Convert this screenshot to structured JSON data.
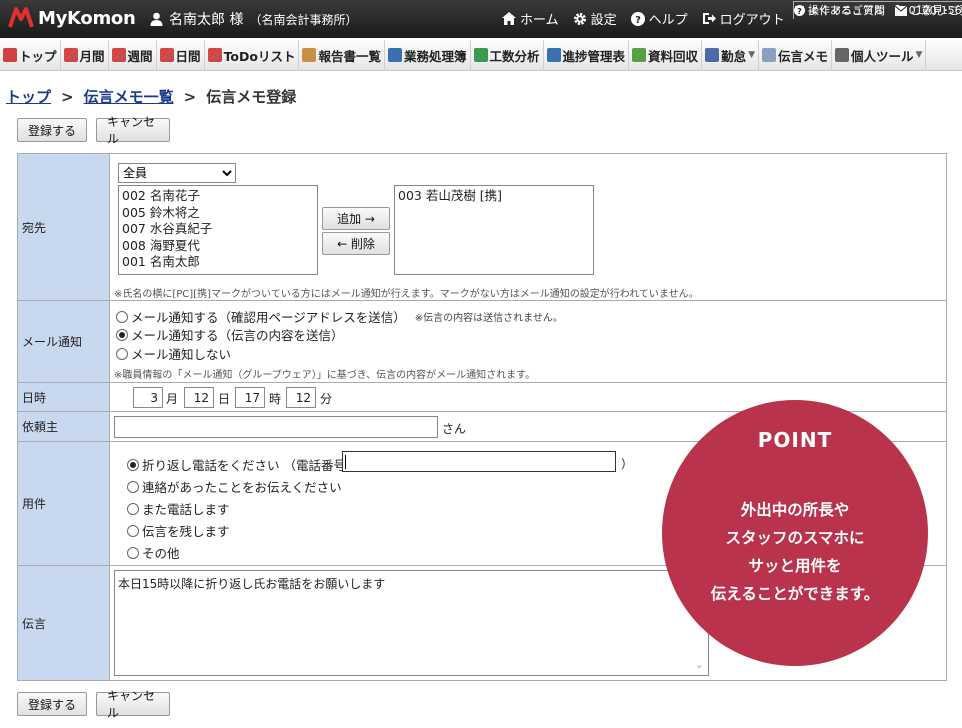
{
  "header": {
    "logo": "MyKomon",
    "user_name": "名南太郎 様",
    "user_org": "（名南会計事務所）",
    "nav": [
      {
        "label": "ホーム",
        "icon": "home-icon"
      },
      {
        "label": "設定",
        "icon": "gear-icon"
      },
      {
        "label": "ヘルプ",
        "icon": "help-icon"
      },
      {
        "label": "ログアウト",
        "icon": "logout-icon"
      }
    ],
    "manual": "操作マニュアル",
    "phone": "0120-156027",
    "faq": "よくあるご質問",
    "feedback": "ご意見･ご要望"
  },
  "menu": [
    {
      "label": "トップ",
      "color": "#d04040"
    },
    {
      "label": "月間",
      "color": "#d04848"
    },
    {
      "label": "週間",
      "color": "#d04848"
    },
    {
      "label": "日間",
      "color": "#d04848"
    },
    {
      "label": "ToDoリスト",
      "color": "#d04848"
    },
    {
      "label": "報告書一覧",
      "color": "#c89040"
    },
    {
      "label": "業務処理簿",
      "color": "#3a70b0"
    },
    {
      "label": "工数分析",
      "color": "#3a9a50"
    },
    {
      "label": "進捗管理表",
      "color": "#3a70b0"
    },
    {
      "label": "資料回収",
      "color": "#58a048"
    },
    {
      "label": "勤怠",
      "color": "#4a6aa8",
      "dropdown": true
    },
    {
      "label": "伝言メモ",
      "color": "#8aa0c0"
    },
    {
      "label": "個人ツール",
      "color": "#666666",
      "dropdown": true
    }
  ],
  "breadcrumb": {
    "top": "トップ",
    "list": "伝言メモ一覧",
    "current": "伝言メモ登録",
    "sep": ">"
  },
  "buttons": {
    "register": "登録する",
    "cancel": "キャンセル"
  },
  "form": {
    "to": {
      "label": "宛先",
      "group_selected": "全員",
      "candidates": [
        "002 名南花子",
        "005 鈴木将之",
        "007 水谷真紀子",
        "008 海野夏代",
        "001 名南太郎"
      ],
      "add_button": "追加 →",
      "remove_button": "← 削除",
      "selected": [
        "003 若山茂樹 [携]"
      ],
      "note": "※氏名の横に[PC][携]マークがついている方にはメール通知が行えます。マークがない方はメール通知の設定が行われていません。"
    },
    "mail": {
      "label": "メール通知",
      "option1": "メール通知する（確認用ページアドレスを送信）",
      "option1_note": "※伝言の内容は送信されません。",
      "option2": "メール通知する（伝言の内容を送信）",
      "option3": "メール通知しない",
      "selected": 2,
      "note": "※職員情報の「メール通知（グループウェア）」に基づき、伝言の内容がメール通知されます。"
    },
    "datetime": {
      "label": "日時",
      "month": "3",
      "month_unit": "月",
      "day": "12",
      "day_unit": "日",
      "hour": "17",
      "hour_unit": "時",
      "minute": "12",
      "minute_unit": "分"
    },
    "requester": {
      "label": "依頼主",
      "value": "",
      "suffix": "さん"
    },
    "purpose": {
      "label": "用件",
      "options": [
        "折り返し電話をください （電話番号：",
        "連絡があったことをお伝えください",
        "また電話します",
        "伝言を残します",
        "その他"
      ],
      "phone_close": "）",
      "selected": 0
    },
    "message": {
      "label": "伝言",
      "value": "本日15時以降に折り返し氏お電話をお願いします"
    }
  },
  "point": {
    "title": "POINT",
    "lines": [
      "外出中の所長や",
      "スタッフのスマホに",
      "サッと用件を",
      "伝えることができます。"
    ],
    "color": "#b8334b"
  }
}
